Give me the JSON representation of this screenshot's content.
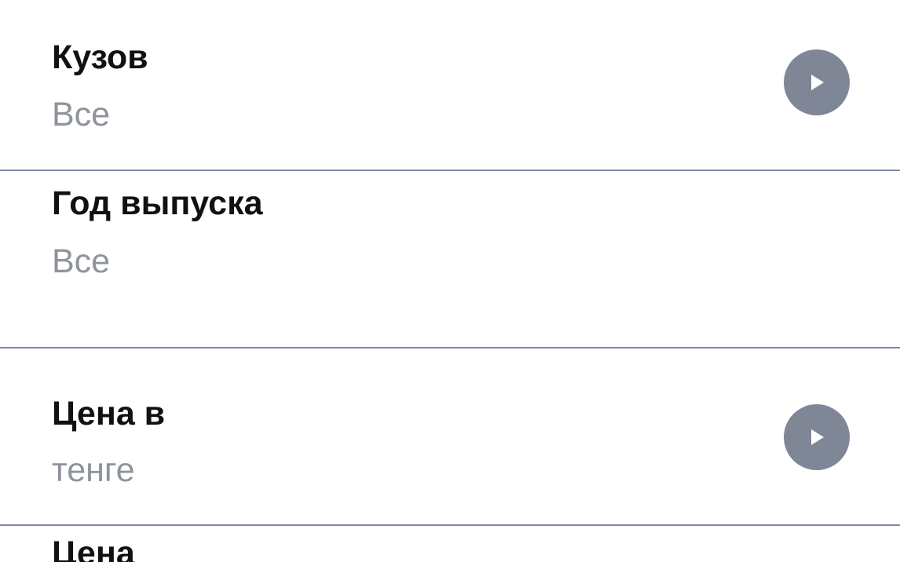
{
  "filters": [
    {
      "label": "Кузов",
      "value": "Все",
      "icon": "chevron-right-icon"
    },
    {
      "label": "Год выпуска",
      "value": "Все"
    },
    {
      "label": "Цена в",
      "value": "тенге",
      "icon": "chevron-right-icon"
    },
    {
      "label": "Цена"
    }
  ],
  "colors": {
    "label": "#111111",
    "value": "#8e939c",
    "chevron_bg": "#7f8797",
    "divider": "#7d8aa6"
  }
}
